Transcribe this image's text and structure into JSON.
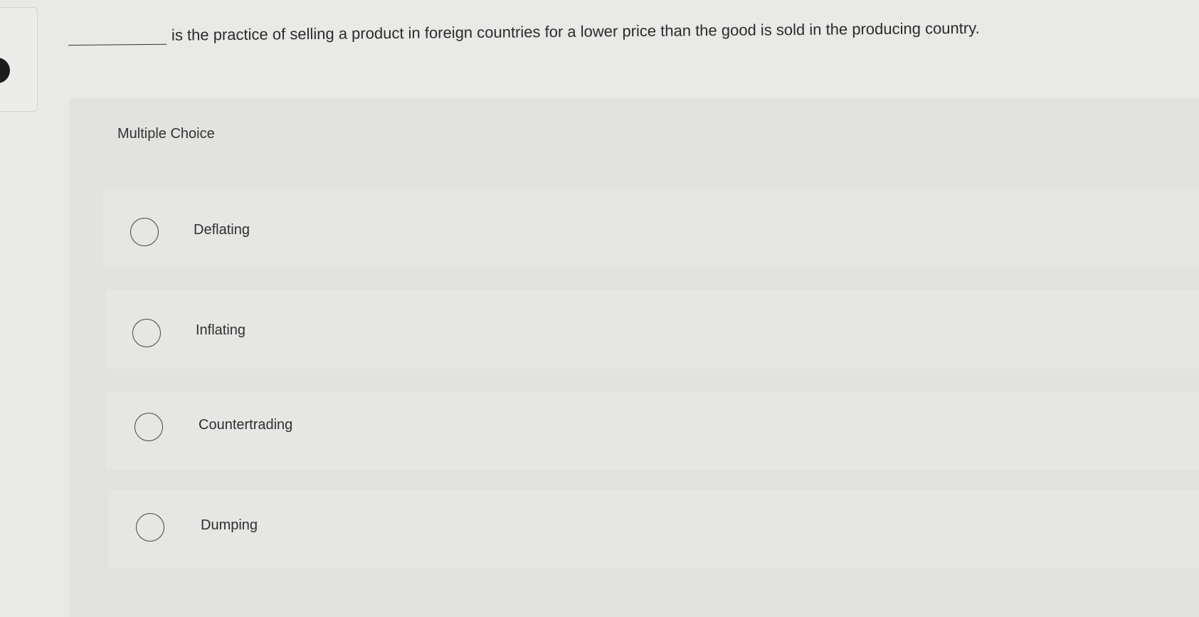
{
  "question": {
    "text": "is the practice of selling a product in foreign countries for a lower price than the good is sold in the producing country."
  },
  "section": {
    "label": "Multiple Choice"
  },
  "options": [
    {
      "label": "Deflating"
    },
    {
      "label": "Inflating"
    },
    {
      "label": "Countertrading"
    },
    {
      "label": "Dumping"
    }
  ],
  "icons": {
    "radio": "radio-circle-icon"
  }
}
